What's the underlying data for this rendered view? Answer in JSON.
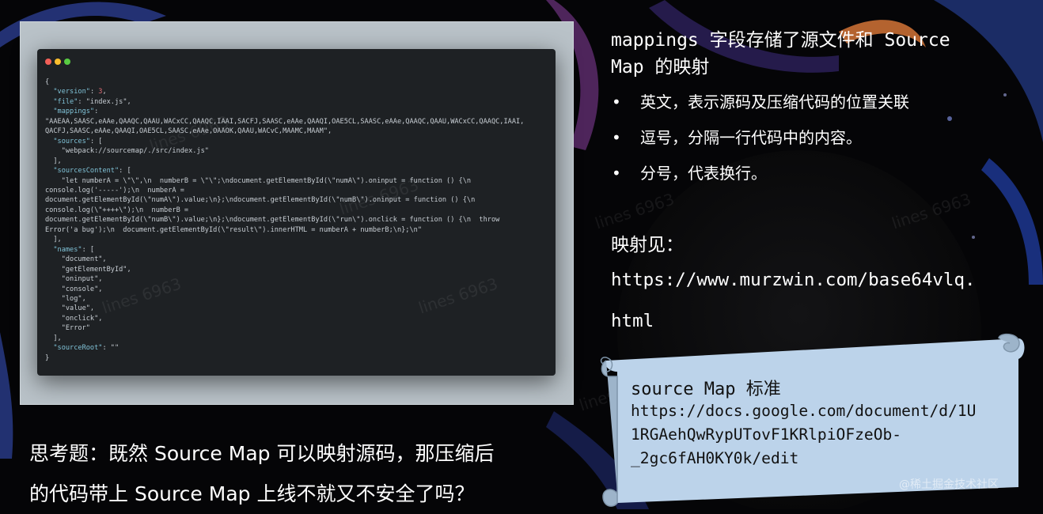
{
  "code_window": {
    "lines": [
      "{",
      "  \"version\": 3,",
      "  \"file\": \"index.js\",",
      "  \"mappings\":",
      "\"AAEAA,SAASC,eAAe,QAAQC,QAAU,WACxCC,QAAQC,IAAI,SACFJ,SAASC,eAAe,QAAQI,OAE5CL,SAASC,eAAe,QAAQC,QAAU,WACxCC,QAAQC,IAAI,",
      "QACFJ,SAASC,eAAe,QAAQI,OAE5CL,SAASC,eAAe,OAAOK,QAAU,WACvC,MAAMC,MAAM\",",
      "  \"sources\": [",
      "    \"webpack://sourcemap/./src/index.js\"",
      "  ],",
      "  \"sourcesContent\": [",
      "    \"let numberA = \\\"\\\",\\n  numberB = \\\"\\\";\\ndocument.getElementById(\\\"numA\\\").oninput = function () {\\n",
      "console.log('-----');\\n  numberA =",
      "document.getElementById(\\\"numA\\\").value;\\n};\\ndocument.getElementById(\\\"numB\\\").oninput = function () {\\n",
      "console.log(\\\"++++\\\");\\n  numberB =",
      "document.getElementById(\\\"numB\\\").value;\\n};\\ndocument.getElementById(\\\"run\\\").onclick = function () {\\n  throw",
      "Error('a bug');\\n  document.getElementById(\\\"result\\\").innerHTML = numberA + numberB;\\n};\\n\"",
      "  ],",
      "  \"names\": [",
      "    \"document\",",
      "    \"getElementById\",",
      "    \"oninput\",",
      "    \"console\",",
      "    \"log\",",
      "    \"value\",",
      "    \"onclick\",",
      "    \"Error\"",
      "  ],",
      "  \"sourceRoot\": \"\"",
      "}"
    ]
  },
  "watermark": "lines 6963",
  "headline_line1": "mappings 字段存储了源文件和 Source",
  "headline_line2": "Map 的映射",
  "bullets": [
    "英文，表示源码及压缩代码的位置关联",
    "逗号，分隔一行代码中的内容。",
    "分号，代表换行。"
  ],
  "bullet_mark": "•",
  "mapping_label": "映射见：",
  "mapping_url_line1": "https://www.murzwin.com/base64vlq.",
  "mapping_url_line2": "html",
  "scroll": {
    "title": "source Map 标准",
    "url_line1": "https://docs.google.com/document/d/1U",
    "url_line2": "1RGAehQwRypUTovF1KRlpiOFzeOb-",
    "url_line3": "_2gc6fAH0KY0k/edit"
  },
  "question_line1": "思考题：既然 Source Map 可以映射源码，那压缩后",
  "question_line2": "的代码带上 Source Map 上线不就又不安全了吗？",
  "footer_credit": "@稀土掘金技术社区",
  "colors": {
    "background": "#050507",
    "panel": "#b9c2c8",
    "code_bg": "#1e2124",
    "scroll": "#bcd3ea",
    "scroll_edge": "#7f95aa"
  }
}
